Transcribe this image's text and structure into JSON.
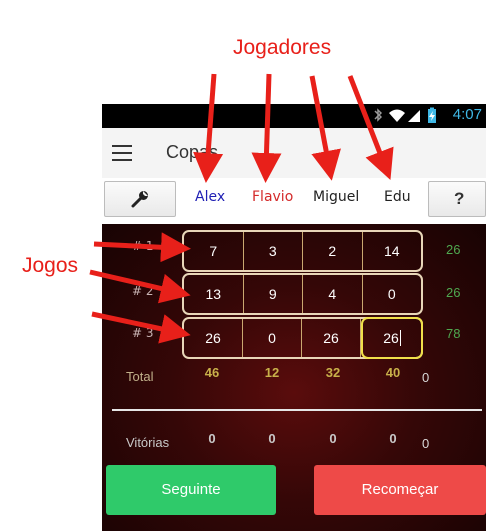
{
  "annotations": {
    "players_label": "Jogadores",
    "games_label": "Jogos"
  },
  "status_bar": {
    "time": "4:07",
    "icons": [
      "bluetooth-muted-icon",
      "wifi-icon",
      "signal-icon",
      "battery-charging-icon"
    ]
  },
  "app_bar": {
    "title": "Copas",
    "menu_icon": "hamburger-menu-icon"
  },
  "players_bar": {
    "settings_icon": "wrench-icon",
    "help_label": "?",
    "players": [
      {
        "name": "Alex",
        "color": "#1f1fb4"
      },
      {
        "name": "Flavio",
        "color": "#d42a2a"
      },
      {
        "name": "Miguel",
        "color": "#222222"
      },
      {
        "name": "Edu",
        "color": "#222222"
      }
    ]
  },
  "games": [
    {
      "label": "# 1",
      "scores": [
        "7",
        "3",
        "2",
        "14"
      ],
      "total": "26"
    },
    {
      "label": "# 2",
      "scores": [
        "13",
        "9",
        "4",
        "0"
      ],
      "total": "26"
    },
    {
      "label": "# 3",
      "scores": [
        "26",
        "0",
        "26",
        "26"
      ],
      "total": "78"
    }
  ],
  "totals": {
    "label": "Total",
    "values": [
      "46",
      "12",
      "32",
      "40"
    ],
    "extra": "0"
  },
  "victories": {
    "label": "Vitórias",
    "values": [
      "0",
      "0",
      "0",
      "0"
    ],
    "extra": "0"
  },
  "buttons": {
    "next": "Seguinte",
    "restart": "Recomeçar"
  },
  "colors": {
    "accent_green": "#2fca6a",
    "accent_red": "#ee4a48",
    "annotation_red": "#e8201a"
  }
}
